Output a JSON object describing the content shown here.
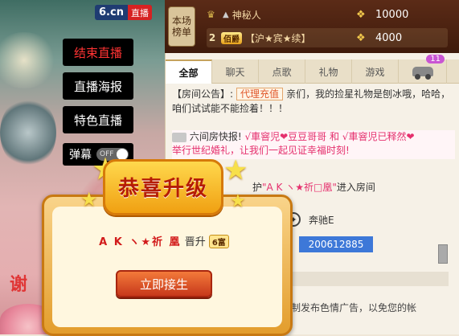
{
  "video": {
    "logo_text": "6.cn",
    "live_badge": "直播",
    "buttons": {
      "end_live": "结束直播",
      "live_poster": "直播海报",
      "special_live": "特色直播"
    },
    "barrage": {
      "label": "弹幕",
      "toggle_state": "OFF"
    },
    "thanks_text": "谢"
  },
  "ranking": {
    "badge_text": "本场\n榜单",
    "rows": [
      {
        "rank": "",
        "name": "神秘人",
        "vip": "",
        "amount": "10000"
      },
      {
        "rank": "2",
        "name": "【沪★宾★续】",
        "vip": "佰爵",
        "amount": "4000"
      }
    ]
  },
  "chat": {
    "tabs": [
      "全部",
      "聊天",
      "点歌",
      "礼物",
      "游戏"
    ],
    "car_tab_badge": "11",
    "notice": {
      "label": "【房间公告】:",
      "tag": "代理充值",
      "text": "亲们，我的捡星礼物是刨冰哦，哈哈，咱们试试能不能捡着！！！"
    },
    "broadcast": {
      "label": "六间房快报!",
      "line1": "√車窨児❤豆豆哥哥 和 √車窨児已释然❤",
      "line2": "举行世纪婚礼，让我们一起见证幸福时刻!"
    },
    "enter": {
      "prefix": "护",
      "name": "\"A K ヽ★祈□凰\"",
      "suffix": "进入房间"
    },
    "car": {
      "name": "奔驰E"
    },
    "id_value": "200612885",
    "bottom_msg": "制发布色情广告，以免您的帐"
  },
  "popup": {
    "title": "恭喜升级",
    "user": "A K ヽ★祈 凰",
    "verb": "晋升",
    "level": "6富",
    "button": "立即接生"
  }
}
